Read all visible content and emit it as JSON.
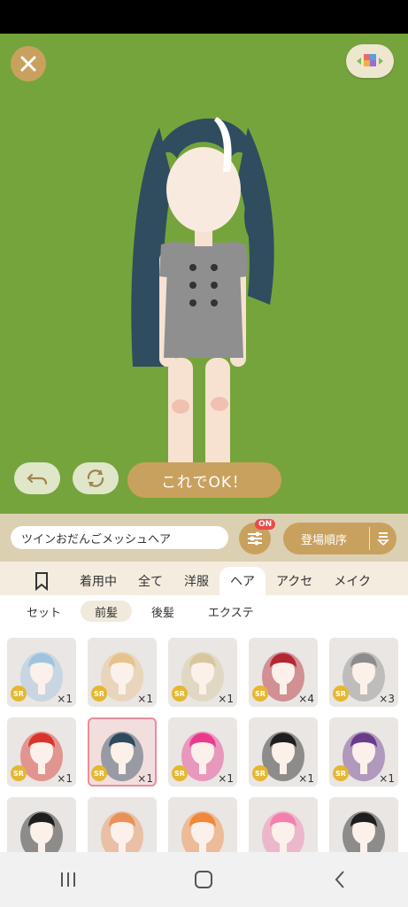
{
  "header": {
    "close_icon": "close-icon",
    "view_icon": "color-grid-icon"
  },
  "stage": {
    "ok_label": "これでOK！",
    "undo_icon": "undo-icon",
    "rotate_icon": "rotate-icon",
    "background_color": "#76a43c"
  },
  "itembar": {
    "item_name": "ツインおだんごメッシュヘア",
    "filter_badge": "ON",
    "sort_label": "登場順序"
  },
  "tabs": [
    {
      "label": "着用中"
    },
    {
      "label": "全て"
    },
    {
      "label": "洋服"
    },
    {
      "label": "ヘア"
    },
    {
      "label": "アクセ"
    },
    {
      "label": "メイク"
    }
  ],
  "active_tab": "ヘア",
  "subtabs": [
    {
      "label": "セット"
    },
    {
      "label": "前髪"
    },
    {
      "label": "後髪"
    },
    {
      "label": "エクステ"
    }
  ],
  "active_subtab": "前髪",
  "items": [
    {
      "rarity": "SR",
      "count": "×1",
      "color": "#9fc3e0"
    },
    {
      "rarity": "SR",
      "count": "×1",
      "color": "#e6c28c"
    },
    {
      "rarity": "SR",
      "count": "×1",
      "color": "#d8c79e"
    },
    {
      "rarity": "SR",
      "count": "×4",
      "color": "#b32833"
    },
    {
      "rarity": "SR",
      "count": "×3",
      "color": "#8c8c8c"
    },
    {
      "rarity": "SR",
      "count": "×1",
      "color": "#d9342b"
    },
    {
      "rarity": "SR",
      "count": "×1",
      "color": "#2d4a5e"
    },
    {
      "rarity": "SR",
      "count": "×1",
      "color": "#e93a8e"
    },
    {
      "rarity": "SR",
      "count": "×1",
      "color": "#1e1e1e"
    },
    {
      "rarity": "SR",
      "count": "×1",
      "color": "#6a3b8c"
    },
    {
      "rarity": "",
      "count": "",
      "color": "#1e1e1e"
    },
    {
      "rarity": "",
      "count": "",
      "color": "#e8925a"
    },
    {
      "rarity": "",
      "count": "",
      "color": "#f0873a"
    },
    {
      "rarity": "",
      "count": "",
      "color": "#f27fae"
    },
    {
      "rarity": "",
      "count": "",
      "color": "#1e1e1e"
    }
  ],
  "navbar": {
    "recent_icon": "recent-apps-icon",
    "home_icon": "home-icon",
    "back_icon": "back-icon"
  }
}
